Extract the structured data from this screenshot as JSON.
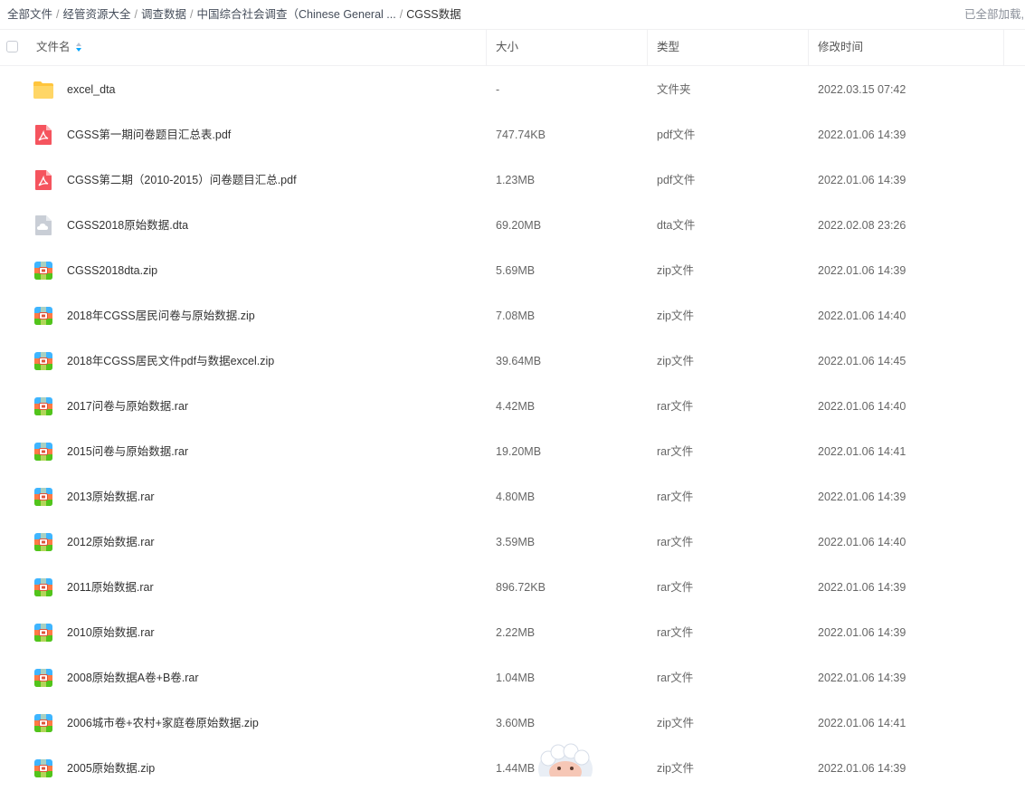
{
  "breadcrumb": {
    "items": [
      "全部文件",
      "经管资源大全",
      "调查数据",
      "中国综合社会调查（Chinese General ..."
    ],
    "current": "CGSS数据"
  },
  "load_status": "已全部加载,",
  "columns": {
    "name": "文件名",
    "size": "大小",
    "type": "类型",
    "modified": "修改时间"
  },
  "files": [
    {
      "icon": "folder-icon",
      "name": "excel_dta",
      "size": "-",
      "type": "文件夹",
      "modified": "2022.03.15 07:42"
    },
    {
      "icon": "pdf-icon",
      "name": "CGSS第一期问卷题目汇总表.pdf",
      "size": "747.74KB",
      "type": "pdf文件",
      "modified": "2022.01.06 14:39"
    },
    {
      "icon": "pdf-icon",
      "name": "CGSS第二期（2010-2015）问卷题目汇总.pdf",
      "size": "1.23MB",
      "type": "pdf文件",
      "modified": "2022.01.06 14:39"
    },
    {
      "icon": "cloud-file-icon",
      "name": "CGSS2018原始数据.dta",
      "size": "69.20MB",
      "type": "dta文件",
      "modified": "2022.02.08 23:26"
    },
    {
      "icon": "archive-icon",
      "name": "CGSS2018dta.zip",
      "size": "5.69MB",
      "type": "zip文件",
      "modified": "2022.01.06 14:39"
    },
    {
      "icon": "archive-icon",
      "name": "2018年CGSS居民问卷与原始数据.zip",
      "size": "7.08MB",
      "type": "zip文件",
      "modified": "2022.01.06 14:40"
    },
    {
      "icon": "archive-icon",
      "name": "2018年CGSS居民文件pdf与数据excel.zip",
      "size": "39.64MB",
      "type": "zip文件",
      "modified": "2022.01.06 14:45"
    },
    {
      "icon": "archive-icon",
      "name": "2017问卷与原始数据.rar",
      "size": "4.42MB",
      "type": "rar文件",
      "modified": "2022.01.06 14:40"
    },
    {
      "icon": "archive-icon",
      "name": "2015问卷与原始数据.rar",
      "size": "19.20MB",
      "type": "rar文件",
      "modified": "2022.01.06 14:41"
    },
    {
      "icon": "archive-icon",
      "name": "2013原始数据.rar",
      "size": "4.80MB",
      "type": "rar文件",
      "modified": "2022.01.06 14:39"
    },
    {
      "icon": "archive-icon",
      "name": "2012原始数据.rar",
      "size": "3.59MB",
      "type": "rar文件",
      "modified": "2022.01.06 14:40"
    },
    {
      "icon": "archive-icon",
      "name": "2011原始数据.rar",
      "size": "896.72KB",
      "type": "rar文件",
      "modified": "2022.01.06 14:39"
    },
    {
      "icon": "archive-icon",
      "name": "2010原始数据.rar",
      "size": "2.22MB",
      "type": "rar文件",
      "modified": "2022.01.06 14:39"
    },
    {
      "icon": "archive-icon",
      "name": "2008原始数据A卷+B卷.rar",
      "size": "1.04MB",
      "type": "rar文件",
      "modified": "2022.01.06 14:39"
    },
    {
      "icon": "archive-icon",
      "name": "2006城市卷+农村+家庭卷原始数据.zip",
      "size": "3.60MB",
      "type": "zip文件",
      "modified": "2022.01.06 14:41"
    },
    {
      "icon": "archive-icon",
      "name": "2005原始数据.zip",
      "size": "1.44MB",
      "type": "zip文件",
      "modified": "2022.01.06 14:39"
    }
  ],
  "colors": {
    "folder": "#ffc53d",
    "pdf": "#f5545e",
    "cloud_file": "#c9ced6",
    "archive_top": "#3fb5ff",
    "archive_mid": "#ff7a45",
    "archive_bottom": "#52c41a",
    "sort_active": "#06a7ff"
  }
}
